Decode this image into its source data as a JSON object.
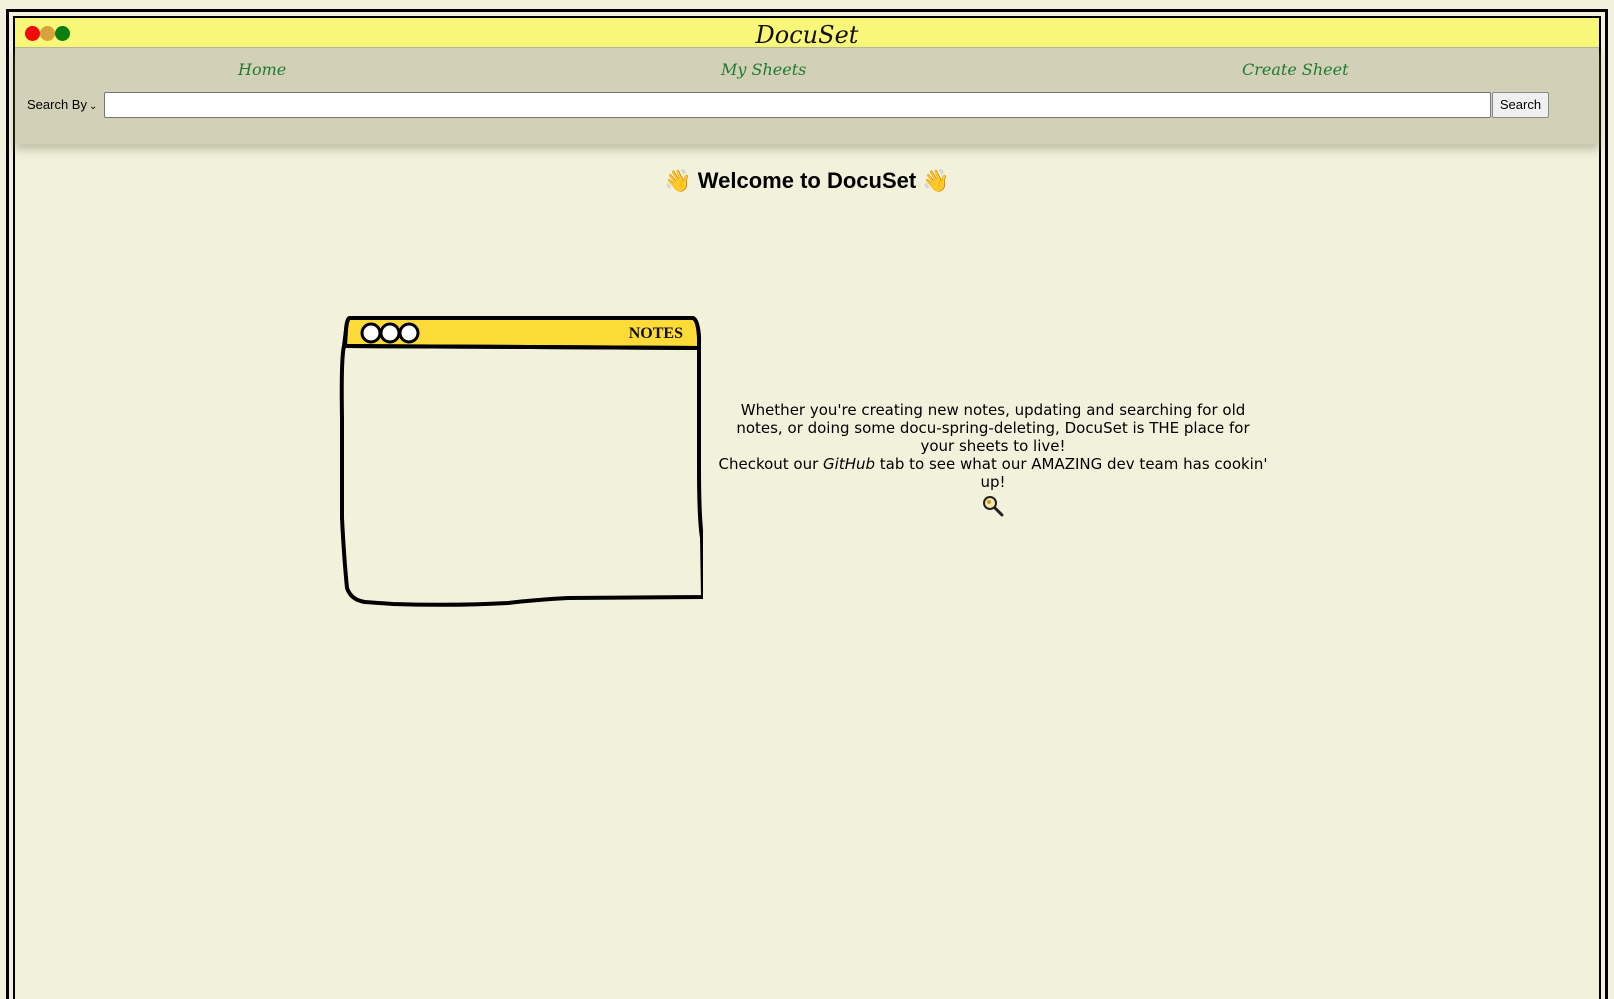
{
  "window": {
    "title": "DocuSet",
    "controls": [
      "close-dot",
      "minimize-dot",
      "maximize-dot"
    ],
    "control_colors": [
      "#f10a0a",
      "#d8a33a",
      "#0b7d11"
    ]
  },
  "nav": {
    "home": "Home",
    "my_sheets": "My Sheets",
    "create_sheet": "Create Sheet"
  },
  "search": {
    "select_label": "Search By",
    "input_value": "",
    "button_label": "Search"
  },
  "main": {
    "welcome_emoji": "👋",
    "welcome_text": "Welcome to DocuSet",
    "illustration_label": "NOTES",
    "blurb_line1": "Whether you're creating new notes, updating and searching for old notes, or doing some docu-spring-deleting, DocuSet is THE place for your sheets to live!",
    "blurb_line2_prefix": "Checkout our ",
    "blurb_line2_em": "GitHub",
    "blurb_line2_suffix": " tab to see what our AMAZING dev team has cookin' up!",
    "blurb_icon": "magnifier-icon"
  },
  "colors": {
    "titlebar": "#f8f778",
    "navbar": "#d2d1b7",
    "page": "#f2f2dc",
    "nav_link": "#1f7a33",
    "notes_header": "#fcdb38"
  }
}
